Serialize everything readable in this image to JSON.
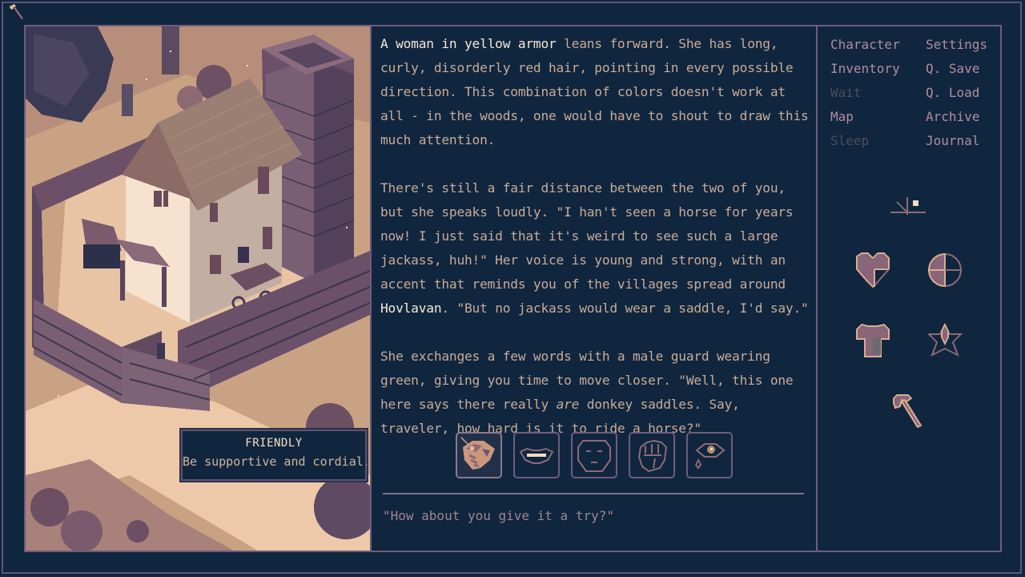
{
  "scene": {
    "tooltip": {
      "title": "FRIENDLY",
      "description": "Be supportive and cordial."
    }
  },
  "narrative": {
    "p1_highlight": "A woman in yellow armor",
    "p1_rest": " leans forward. She has long, curly, disorderly red hair, pointing in every possible direction. This combination of colors doesn't work at all - in the woods, one would have to shout to draw this much attention.",
    "p2_before": "There's still a fair distance between the two of you, but she speaks loudly. \"I han't seen a horse for years now! I just said that it's weird to see such a large jackass, huh!\" Her voice is young and strong, with an accent that reminds you of the villages spread around ",
    "p2_place": "Hovlavan",
    "p2_after": ". \"But no jackass would wear a saddle, I'd say.\"",
    "p3_before": "She exchanges a few words with a male guard wearing green, giving you time to move closer. \"Well, this one here says there really ",
    "p3_emphasis": "are",
    "p3_after": " donkey saddles. Say, traveler, how hard is it to ride a horse?\""
  },
  "choices": [
    {
      "id": "friendly",
      "icon": "handshake-icon",
      "selected": true
    },
    {
      "id": "smile",
      "icon": "lips-icon",
      "selected": false
    },
    {
      "id": "neutral",
      "icon": "neutral-face-icon",
      "selected": false
    },
    {
      "id": "aggressive",
      "icon": "fist-icon",
      "selected": false
    },
    {
      "id": "sad",
      "icon": "crying-eye-icon",
      "selected": false
    }
  ],
  "response": "\"How about you give it a try?\"",
  "menu": {
    "left": [
      {
        "label": "Character",
        "enabled": true
      },
      {
        "label": "Inventory",
        "enabled": true
      },
      {
        "label": "Wait",
        "enabled": false
      },
      {
        "label": "Map",
        "enabled": true
      },
      {
        "label": "Sleep",
        "enabled": false
      }
    ],
    "right": [
      {
        "label": "Settings",
        "enabled": true
      },
      {
        "label": "Q. Save",
        "enabled": true
      },
      {
        "label": "Q. Load",
        "enabled": true
      },
      {
        "label": "Archive",
        "enabled": true
      },
      {
        "label": "Journal",
        "enabled": true
      }
    ]
  },
  "status": {
    "time_of_day": "sundial-icon",
    "health": "heart-icon",
    "nourishment": "round-meter-icon",
    "clothing": "tunic-icon",
    "morale": "star-icon",
    "weapon": "axe-icon"
  },
  "colors": {
    "background": "#10263e",
    "border": "#6e5d7c",
    "text": "#c9ab98",
    "highlight": "#f6e6d6",
    "menu_text": "#b08e9e",
    "menu_disabled": "#4a4e5a"
  }
}
